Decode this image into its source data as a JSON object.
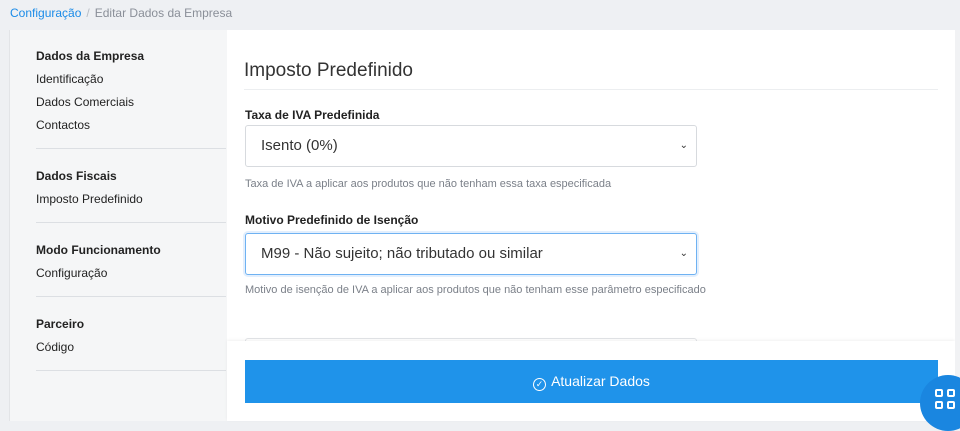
{
  "breadcrumb": {
    "root": "Configuração",
    "current": "Editar Dados da Empresa"
  },
  "sidebar": {
    "groups": [
      {
        "title": "Dados da Empresa",
        "items": [
          "Identificação",
          "Dados Comerciais",
          "Contactos"
        ]
      },
      {
        "title": "Dados Fiscais",
        "items": [
          "Imposto Predefinido"
        ]
      },
      {
        "title": "Modo Funcionamento",
        "items": [
          "Configuração"
        ]
      },
      {
        "title": "Parceiro",
        "items": [
          "Código"
        ]
      }
    ]
  },
  "main": {
    "section_title": "Imposto Predefinido",
    "iva_rate": {
      "label": "Taxa de IVA Predefinida",
      "value": "Isento (0%)",
      "help": "Taxa de IVA a aplicar aos produtos que não tenham essa taxa especificada"
    },
    "exemption": {
      "label": "Motivo Predefinido de Isenção",
      "value": "M99 - Não sujeito; não tributado ou similar",
      "help": "Motivo de isenção de IVA a aplicar aos produtos que não tenham esse parâmetro especificado"
    },
    "submit_label": "Atualizar Dados"
  },
  "icons": {
    "chevron": "chevron-down-icon",
    "submit": "check-circle-icon",
    "fab": "grid-icon"
  },
  "colors": {
    "accent": "#1f93ea",
    "link": "#1a8be8"
  }
}
